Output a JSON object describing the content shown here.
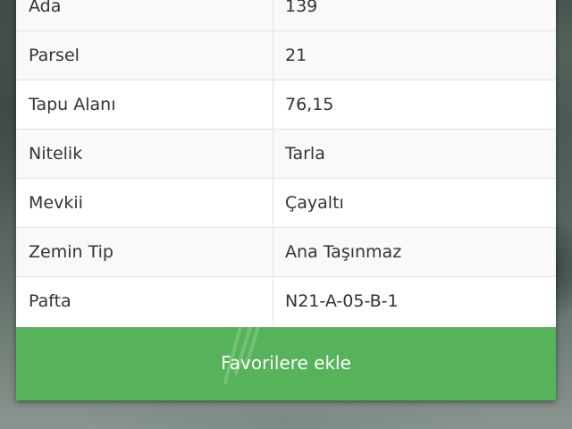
{
  "parcel_details": {
    "rows": [
      {
        "label": "Ada",
        "value": "139"
      },
      {
        "label": "Parsel",
        "value": "21"
      },
      {
        "label": "Tapu Alanı",
        "value": "76,15"
      },
      {
        "label": "Nitelik",
        "value": "Tarla"
      },
      {
        "label": "Mevkii",
        "value": "Çayaltı"
      },
      {
        "label": "Zemin Tip",
        "value": "Ana Taşınmaz"
      },
      {
        "label": "Pafta",
        "value": "N21-A-05-B-1"
      }
    ]
  },
  "actions": {
    "add_favorites_label": "Favorilere ekle"
  },
  "colors": {
    "button_green": "#56b35a",
    "row_alt": "#f9f9f9",
    "text": "#333333"
  }
}
